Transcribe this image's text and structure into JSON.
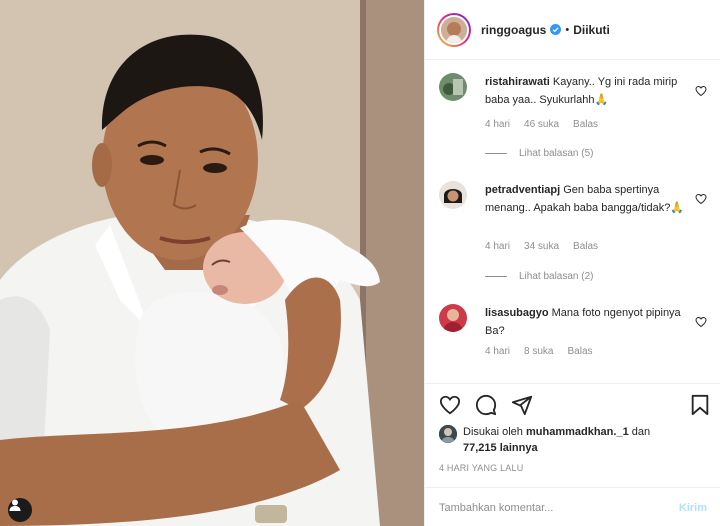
{
  "post": {
    "username": "ringgoagus",
    "follow_status": "Diikuti",
    "dot": "•"
  },
  "comments": [
    {
      "username": "ristahirawati",
      "text": "Kayany.. Yg ini rada mirip baba yaa.. Syukurlahh🙏",
      "time": "4 hari",
      "likes": "46 suka",
      "reply": "Balas",
      "view_replies": "Lihat balasan (5)"
    },
    {
      "username": "petradventiapj",
      "text": "Gen baba spertinya menang.. Apakah baba bangga/tidak?🙏",
      "time": "4 hari",
      "likes": "34 suka",
      "reply": "Balas",
      "view_replies": "Lihat balasan (2)"
    },
    {
      "username": "lisasubagyo",
      "text": "Mana foto ngenyot pipinya Ba?",
      "time": "4 hari",
      "likes": "8 suka",
      "reply": "Balas"
    }
  ],
  "likes": {
    "prefix": "Disukai oleh",
    "user": "muhammadkhan._1",
    "connector": "dan",
    "count": "77,215 lainnya"
  },
  "date": "4 HARI YANG LALU",
  "comment_box": {
    "placeholder": "Tambahkan komentar...",
    "send_label": "Kirim"
  },
  "icons": {
    "verified": "verified-badge-icon",
    "like": "heart-icon",
    "comment": "comment-bubble-icon",
    "share": "paper-plane-icon",
    "save": "bookmark-icon"
  },
  "colors": {
    "verified": "#3897f0",
    "send_disabled": "#b2dffc",
    "muted": "#8e8e8e"
  }
}
